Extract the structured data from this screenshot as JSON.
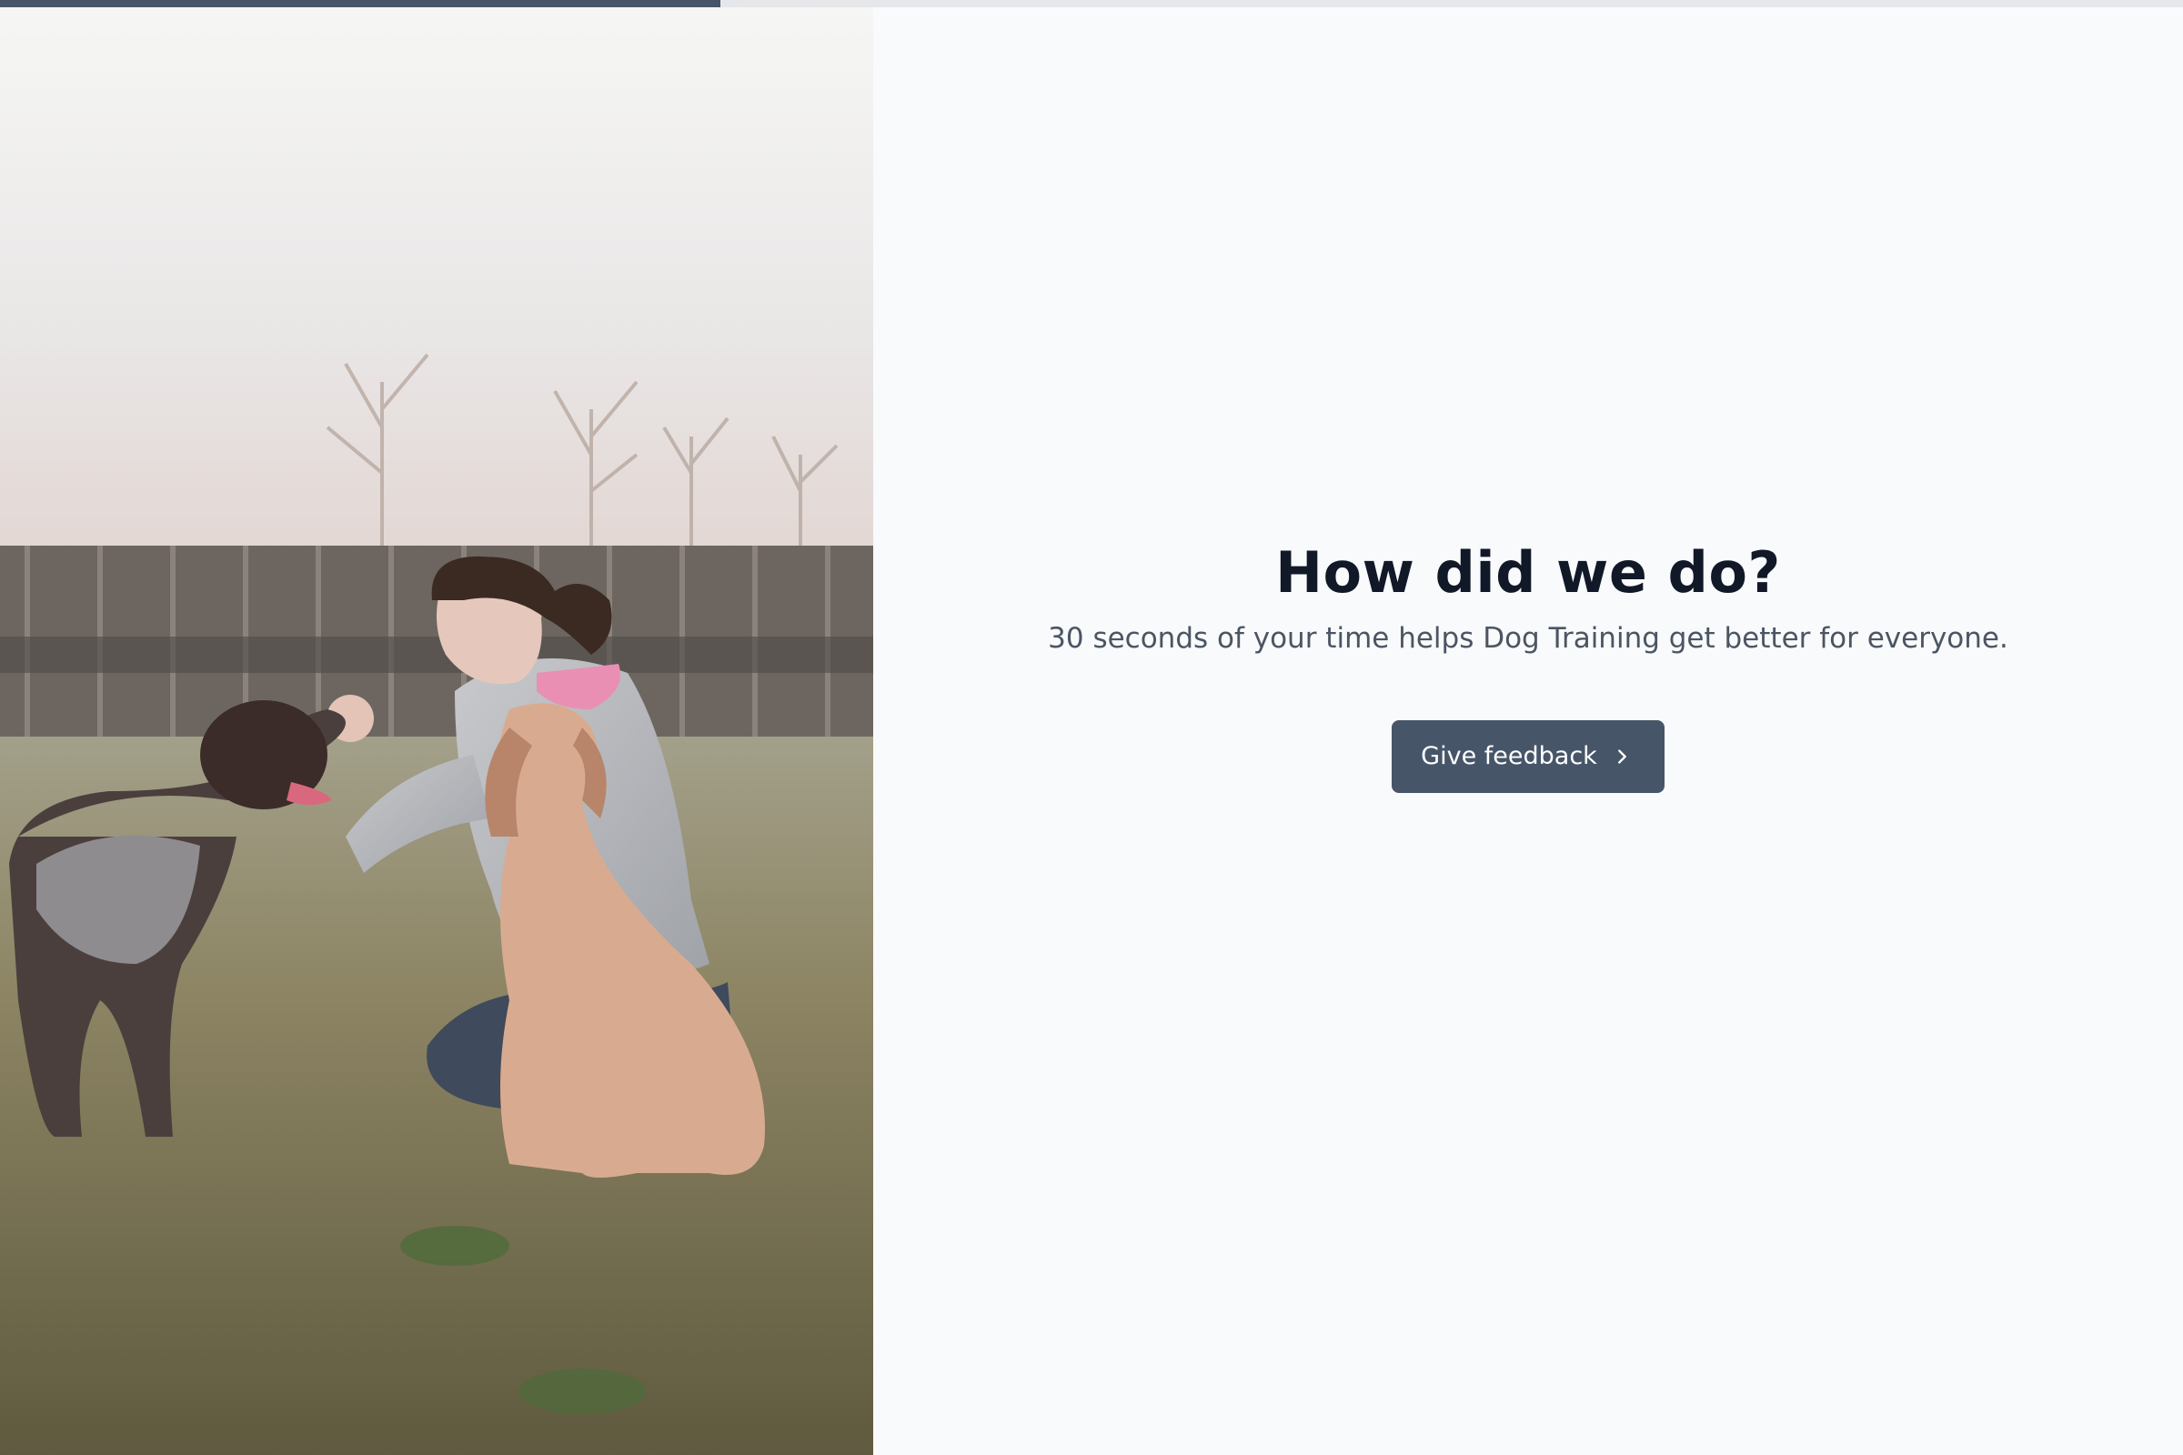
{
  "progress": {
    "value": 0.33,
    "color": "#475569",
    "track_color": "#e5e7eb"
  },
  "hero_image": {
    "subject": "woman kneeling in a grassy field with two dogs"
  },
  "main": {
    "title": "How did we do?",
    "subtitle": "30 seconds of your time helps Dog Training get better for everyone.",
    "cta": {
      "label": "Give feedback",
      "icon": "chevron-right-icon"
    }
  },
  "colors": {
    "background": "#f8fafc",
    "title": "#111827",
    "subtitle": "#4b5563",
    "button_bg": "#475569",
    "button_text": "#ffffff"
  }
}
